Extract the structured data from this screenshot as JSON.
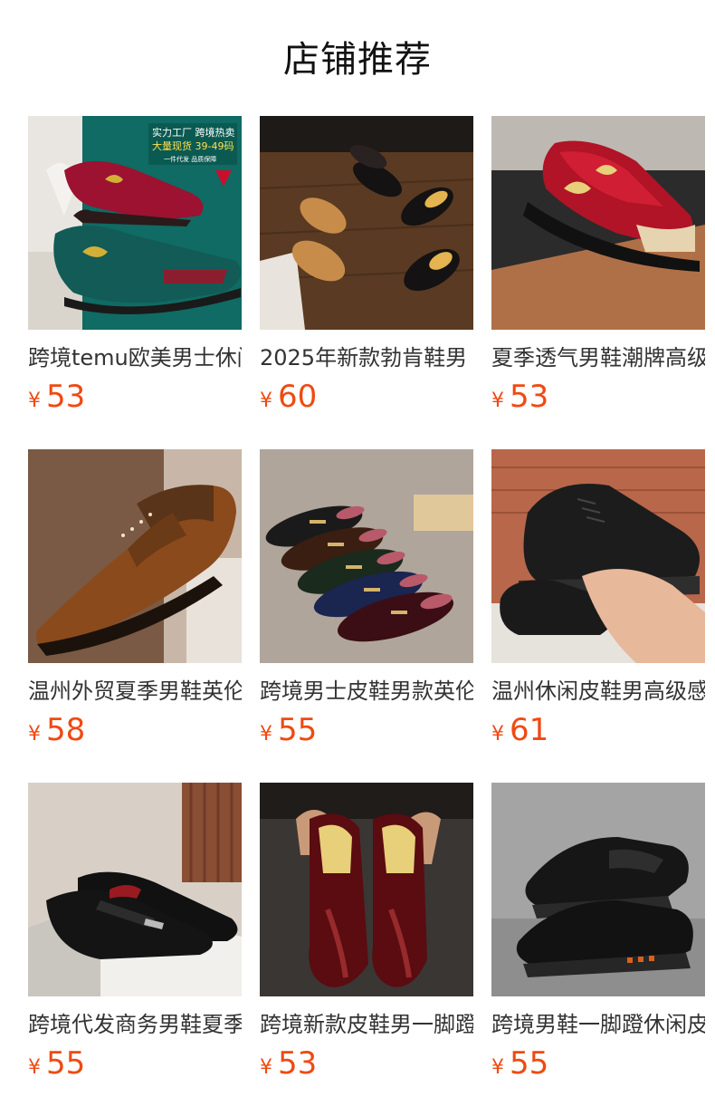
{
  "section": {
    "title": "店铺推荐"
  },
  "products": [
    {
      "title": "跨境temu欧美男士休闲皮鞋",
      "currency": "¥",
      "price": "53",
      "image_icon": "velvet-loafer-shoe-icon",
      "banner": {
        "line1": "实力工厂 跨境热卖",
        "line2": "大量现货 39-49码",
        "line3": "一件代发 品质保障"
      },
      "colors": {
        "bg": "#0f6b63",
        "shoe": "#9c1230"
      }
    },
    {
      "title": "2025年新款勃肯鞋男",
      "currency": "¥",
      "price": "60",
      "image_icon": "mule-slipper-icon",
      "colors": {
        "bg": "#5a3a22",
        "shoe": "#c88c4a"
      }
    },
    {
      "title": "夏季透气男鞋潮牌高级感",
      "currency": "¥",
      "price": "53",
      "image_icon": "velvet-slipper-icon",
      "colors": {
        "bg": "#2b2b2b",
        "shoe": "#b01426"
      }
    },
    {
      "title": "温州外贸夏季男鞋英伦风",
      "currency": "¥",
      "price": "58",
      "image_icon": "brogue-shoe-icon",
      "colors": {
        "bg": "#7a5a44",
        "shoe": "#8a4a1c"
      }
    },
    {
      "title": "跨境男士皮鞋男款英伦风",
      "currency": "¥",
      "price": "55",
      "image_icon": "horsebit-loafer-icon",
      "colors": {
        "bg": "#b0a59a",
        "shoe": "#2a2222"
      }
    },
    {
      "title": "温州休闲皮鞋男高级感",
      "currency": "¥",
      "price": "61",
      "image_icon": "leather-lace-up-shoe-icon",
      "colors": {
        "bg": "#b8674a",
        "shoe": "#1c1c1c"
      }
    },
    {
      "title": "跨境代发商务男鞋夏季",
      "currency": "¥",
      "price": "55",
      "image_icon": "penny-loafer-icon",
      "colors": {
        "bg": "#d8d0c6",
        "shoe": "#111111"
      }
    },
    {
      "title": "跨境新款皮鞋男一脚蹬",
      "currency": "¥",
      "price": "53",
      "image_icon": "patent-loafer-icon",
      "colors": {
        "bg": "#3a3634",
        "shoe": "#5a0c10"
      }
    },
    {
      "title": "跨境男鞋一脚蹬休闲皮鞋",
      "currency": "¥",
      "price": "55",
      "image_icon": "slip-on-leather-shoe-icon",
      "colors": {
        "bg": "#8e8e8e",
        "shoe": "#161616"
      }
    }
  ]
}
